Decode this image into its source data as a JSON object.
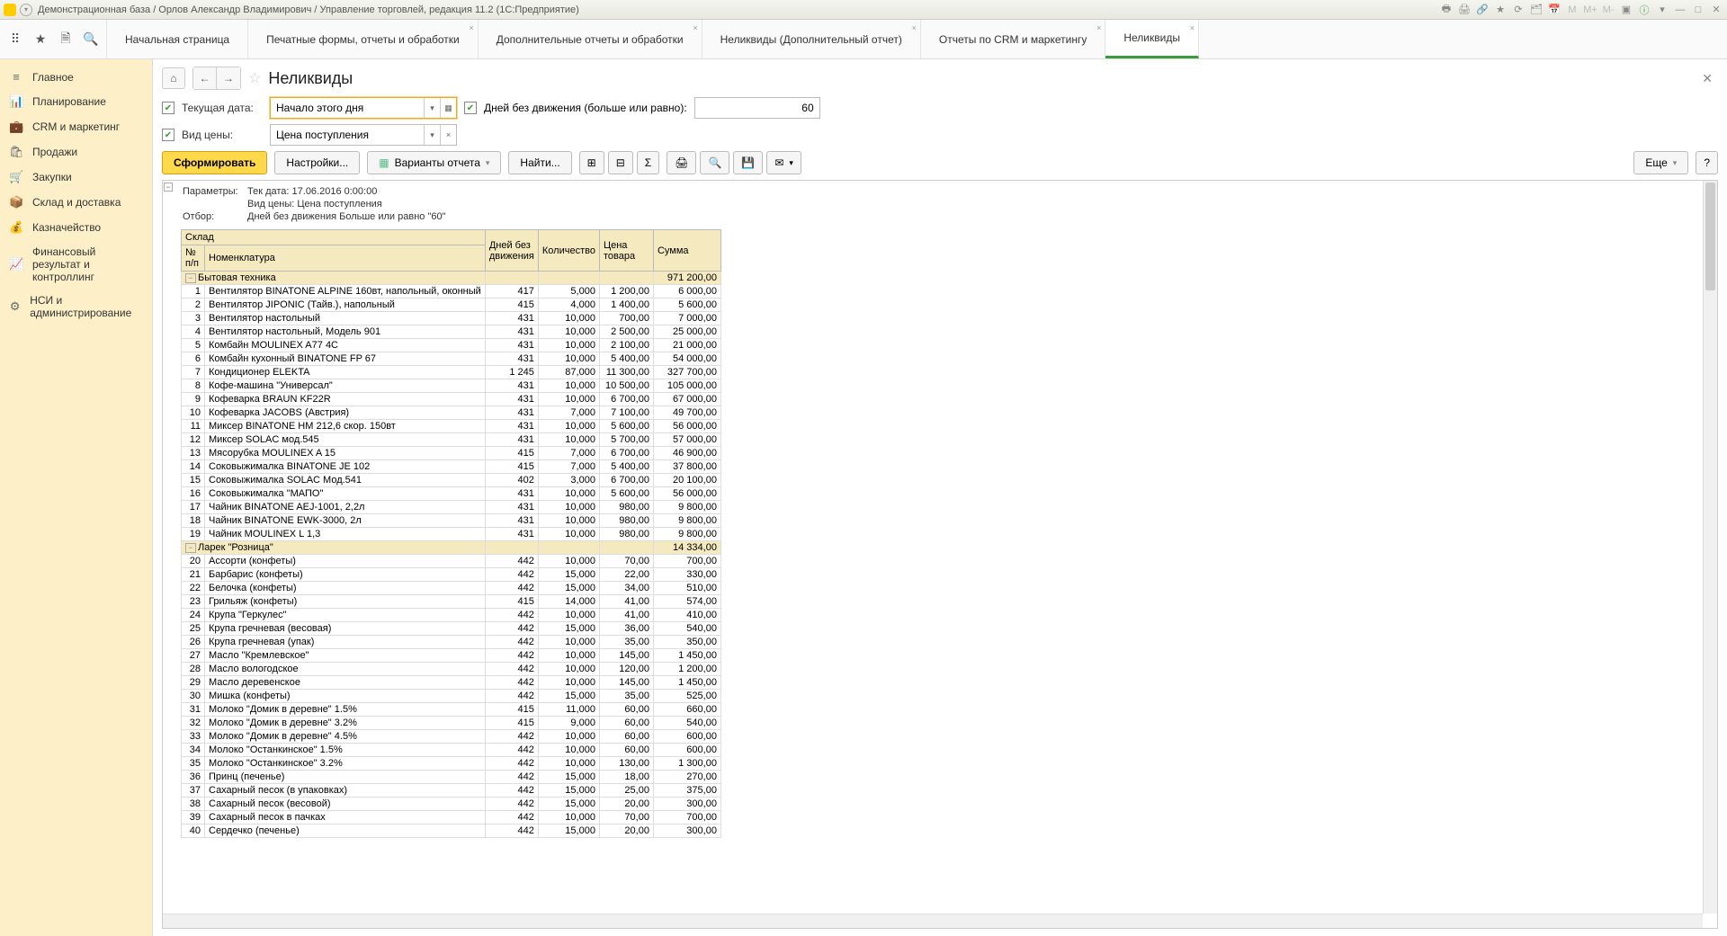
{
  "window_title": "Демонстрационная база / Орлов Александр Владимирович / Управление торговлей, редакция 11.2  (1С:Предприятие)",
  "tabs": [
    {
      "label": "Начальная страница",
      "closable": false
    },
    {
      "label": "Печатные формы, отчеты и обработки",
      "closable": true
    },
    {
      "label": "Дополнительные отчеты и обработки",
      "closable": true
    },
    {
      "label": "Неликвиды (Дополнительный отчет)",
      "closable": true
    },
    {
      "label": "Отчеты по CRM и маркетингу",
      "closable": true
    },
    {
      "label": "Неликвиды",
      "closable": true,
      "active": true
    }
  ],
  "sidebar": [
    {
      "icon": "≡",
      "label": "Главное"
    },
    {
      "icon": "📊",
      "label": "Планирование"
    },
    {
      "icon": "💼",
      "label": "CRM и маркетинг"
    },
    {
      "icon": "🛍",
      "label": "Продажи"
    },
    {
      "icon": "🛒",
      "label": "Закупки"
    },
    {
      "icon": "📦",
      "label": "Склад и доставка"
    },
    {
      "icon": "💰",
      "label": "Казначейство"
    },
    {
      "icon": "📈",
      "label": "Финансовый результат и контроллинг"
    },
    {
      "icon": "⚙",
      "label": "НСИ и администрирование"
    }
  ],
  "page": {
    "title": "Неликвиды"
  },
  "filters": {
    "date_label": "Текущая дата:",
    "date_value": "Начало этого дня",
    "days_label": "Дней без движения (больше или равно):",
    "days_value": "60",
    "price_label": "Вид цены:",
    "price_value": "Цена поступления"
  },
  "toolbar": {
    "generate": "Сформировать",
    "settings": "Настройки...",
    "variants": "Варианты отчета",
    "find": "Найти...",
    "more": "Еще"
  },
  "report_header": {
    "params_label": "Параметры:",
    "params_line1": "Тек дата: 17.06.2016 0:00:00",
    "params_line2": "Вид цены: Цена поступления",
    "filter_label": "Отбор:",
    "filter_line": "Дней без движения Больше или равно \"60\""
  },
  "columns": {
    "warehouse": "Склад",
    "num": "№ п/п",
    "nomenclature": "Номенклатура",
    "days": "Дней без движения",
    "qty": "Количество",
    "price": "Цена товара",
    "sum": "Сумма"
  },
  "groups": [
    {
      "name": "Бытовая техника",
      "sum": "971 200,00",
      "rows": [
        {
          "n": "1",
          "name": "Вентилятор BINATONE ALPINE 160вт, напольный, оконный",
          "d": "417",
          "q": "5,000",
          "p": "1 200,00",
          "s": "6 000,00"
        },
        {
          "n": "2",
          "name": "Вентилятор JIPONIC (Тайв.), напольный",
          "d": "415",
          "q": "4,000",
          "p": "1 400,00",
          "s": "5 600,00"
        },
        {
          "n": "3",
          "name": "Вентилятор настольный",
          "d": "431",
          "q": "10,000",
          "p": "700,00",
          "s": "7 000,00"
        },
        {
          "n": "4",
          "name": "Вентилятор настольный, Модель 901",
          "d": "431",
          "q": "10,000",
          "p": "2 500,00",
          "s": "25 000,00"
        },
        {
          "n": "5",
          "name": "Комбайн MOULINEX  A77 4C",
          "d": "431",
          "q": "10,000",
          "p": "2 100,00",
          "s": "21 000,00"
        },
        {
          "n": "6",
          "name": "Комбайн кухонный BINATONE FP 67",
          "d": "431",
          "q": "10,000",
          "p": "5 400,00",
          "s": "54 000,00"
        },
        {
          "n": "7",
          "name": "Кондиционер ELEKTA",
          "d": "1 245",
          "q": "87,000",
          "p": "11 300,00",
          "s": "327 700,00"
        },
        {
          "n": "8",
          "name": "Кофе-машина \"Универсал\"",
          "d": "431",
          "q": "10,000",
          "p": "10 500,00",
          "s": "105 000,00"
        },
        {
          "n": "9",
          "name": "Кофеварка BRAUN KF22R",
          "d": "431",
          "q": "10,000",
          "p": "6 700,00",
          "s": "67 000,00"
        },
        {
          "n": "10",
          "name": "Кофеварка JACOBS (Австрия)",
          "d": "431",
          "q": "7,000",
          "p": "7 100,00",
          "s": "49 700,00"
        },
        {
          "n": "11",
          "name": "Миксер BINATONE HM 212,6 скор. 150вт",
          "d": "431",
          "q": "10,000",
          "p": "5 600,00",
          "s": "56 000,00"
        },
        {
          "n": "12",
          "name": "Миксер SOLAC мод.545",
          "d": "431",
          "q": "10,000",
          "p": "5 700,00",
          "s": "57 000,00"
        },
        {
          "n": "13",
          "name": "Мясорубка MOULINEX  A 15",
          "d": "415",
          "q": "7,000",
          "p": "6 700,00",
          "s": "46 900,00"
        },
        {
          "n": "14",
          "name": "Соковыжималка  BINATONE JE 102",
          "d": "415",
          "q": "7,000",
          "p": "5 400,00",
          "s": "37 800,00"
        },
        {
          "n": "15",
          "name": "Соковыжималка  SOLAC  Мод.541",
          "d": "402",
          "q": "3,000",
          "p": "6 700,00",
          "s": "20 100,00"
        },
        {
          "n": "16",
          "name": "Соковыжималка \"МАПО\"",
          "d": "431",
          "q": "10,000",
          "p": "5 600,00",
          "s": "56 000,00"
        },
        {
          "n": "17",
          "name": "Чайник BINATONE  AEJ-1001,  2,2л",
          "d": "431",
          "q": "10,000",
          "p": "980,00",
          "s": "9 800,00"
        },
        {
          "n": "18",
          "name": "Чайник BINATONE  EWK-3000,  2л",
          "d": "431",
          "q": "10,000",
          "p": "980,00",
          "s": "9 800,00"
        },
        {
          "n": "19",
          "name": "Чайник MOULINEX L 1,3",
          "d": "431",
          "q": "10,000",
          "p": "980,00",
          "s": "9 800,00"
        }
      ]
    },
    {
      "name": "Ларек \"Розница\"",
      "sum": "14 334,00",
      "rows": [
        {
          "n": "20",
          "name": "Ассорти (конфеты)",
          "d": "442",
          "q": "10,000",
          "p": "70,00",
          "s": "700,00"
        },
        {
          "n": "21",
          "name": "Барбарис (конфеты)",
          "d": "442",
          "q": "15,000",
          "p": "22,00",
          "s": "330,00"
        },
        {
          "n": "22",
          "name": "Белочка (конфеты)",
          "d": "442",
          "q": "15,000",
          "p": "34,00",
          "s": "510,00"
        },
        {
          "n": "23",
          "name": "Грильяж (конфеты)",
          "d": "415",
          "q": "14,000",
          "p": "41,00",
          "s": "574,00"
        },
        {
          "n": "24",
          "name": "Крупа \"Геркулес\"",
          "d": "442",
          "q": "10,000",
          "p": "41,00",
          "s": "410,00"
        },
        {
          "n": "25",
          "name": "Крупа гречневая (весовая)",
          "d": "442",
          "q": "15,000",
          "p": "36,00",
          "s": "540,00"
        },
        {
          "n": "26",
          "name": "Крупа гречневая (упак)",
          "d": "442",
          "q": "10,000",
          "p": "35,00",
          "s": "350,00"
        },
        {
          "n": "27",
          "name": "Масло \"Кремлевское\"",
          "d": "442",
          "q": "10,000",
          "p": "145,00",
          "s": "1 450,00"
        },
        {
          "n": "28",
          "name": "Масло вологодское",
          "d": "442",
          "q": "10,000",
          "p": "120,00",
          "s": "1 200,00"
        },
        {
          "n": "29",
          "name": "Масло деревенское",
          "d": "442",
          "q": "10,000",
          "p": "145,00",
          "s": "1 450,00"
        },
        {
          "n": "30",
          "name": "Мишка (конфеты)",
          "d": "442",
          "q": "15,000",
          "p": "35,00",
          "s": "525,00"
        },
        {
          "n": "31",
          "name": "Молоко \"Домик в деревне\" 1.5%",
          "d": "415",
          "q": "11,000",
          "p": "60,00",
          "s": "660,00"
        },
        {
          "n": "32",
          "name": "Молоко \"Домик в деревне\" 3.2%",
          "d": "415",
          "q": "9,000",
          "p": "60,00",
          "s": "540,00"
        },
        {
          "n": "33",
          "name": "Молоко \"Домик в деревне\" 4.5%",
          "d": "442",
          "q": "10,000",
          "p": "60,00",
          "s": "600,00"
        },
        {
          "n": "34",
          "name": "Молоко \"Останкинское\" 1.5%",
          "d": "442",
          "q": "10,000",
          "p": "60,00",
          "s": "600,00"
        },
        {
          "n": "35",
          "name": "Молоко \"Останкинское\" 3.2%",
          "d": "442",
          "q": "10,000",
          "p": "130,00",
          "s": "1 300,00"
        },
        {
          "n": "36",
          "name": "Принц (печенье)",
          "d": "442",
          "q": "15,000",
          "p": "18,00",
          "s": "270,00"
        },
        {
          "n": "37",
          "name": "Сахарный песок (в упаковках)",
          "d": "442",
          "q": "15,000",
          "p": "25,00",
          "s": "375,00"
        },
        {
          "n": "38",
          "name": "Сахарный песок (весовой)",
          "d": "442",
          "q": "15,000",
          "p": "20,00",
          "s": "300,00"
        },
        {
          "n": "39",
          "name": "Сахарный песок в пачках",
          "d": "442",
          "q": "10,000",
          "p": "70,00",
          "s": "700,00"
        },
        {
          "n": "40",
          "name": "Сердечко (печенье)",
          "d": "442",
          "q": "15,000",
          "p": "20,00",
          "s": "300,00"
        }
      ]
    }
  ]
}
